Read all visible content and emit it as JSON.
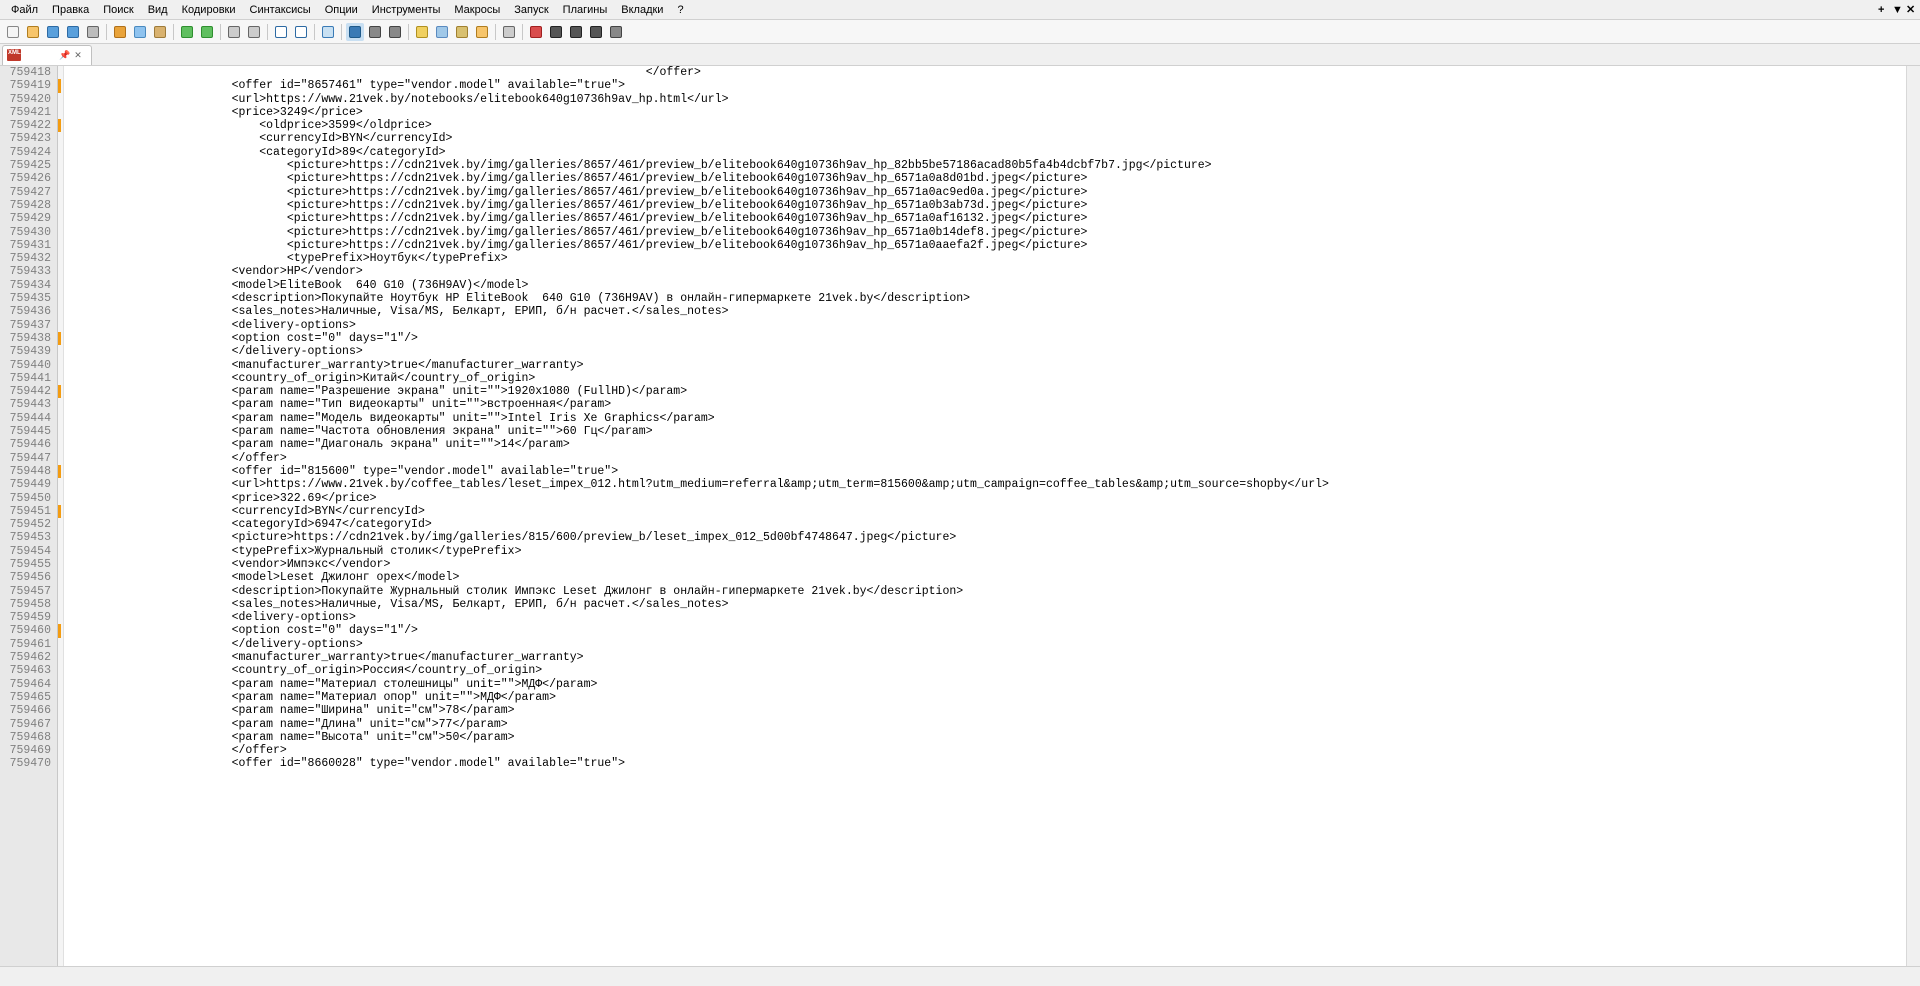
{
  "menu": [
    "Файл",
    "Правка",
    "Поиск",
    "Вид",
    "Кодировки",
    "Синтаксисы",
    "Опции",
    "Инструменты",
    "Макросы",
    "Запуск",
    "Плагины",
    "Вкладки",
    "?"
  ],
  "winbtns": [
    "+",
    "▼",
    "✕"
  ],
  "tab": {
    "pin_icon": "📌",
    "close_icon": "✕"
  },
  "line_start": 759418,
  "modified_lines": [
    759419,
    759422,
    759438,
    759442,
    759448,
    759451,
    759460
  ],
  "code_lines": [
    "                                                                                    </offer>",
    "                        <offer id=\"8657461\" type=\"vendor.model\" available=\"true\">",
    "                        <url>https://www.21vek.by/notebooks/elitebook640g10736h9av_hp.html</url>",
    "                        <price>3249</price>",
    "                            <oldprice>3599</oldprice>",
    "                            <currencyId>BYN</currencyId>",
    "                            <categoryId>89</categoryId>",
    "                                <picture>https://cdn21vek.by/img/galleries/8657/461/preview_b/elitebook640g10736h9av_hp_82bb5be57186acad80b5fa4b4dcbf7b7.jpg</picture>",
    "                                <picture>https://cdn21vek.by/img/galleries/8657/461/preview_b/elitebook640g10736h9av_hp_6571a0a8d01bd.jpeg</picture>",
    "                                <picture>https://cdn21vek.by/img/galleries/8657/461/preview_b/elitebook640g10736h9av_hp_6571a0ac9ed0a.jpeg</picture>",
    "                                <picture>https://cdn21vek.by/img/galleries/8657/461/preview_b/elitebook640g10736h9av_hp_6571a0b3ab73d.jpeg</picture>",
    "                                <picture>https://cdn21vek.by/img/galleries/8657/461/preview_b/elitebook640g10736h9av_hp_6571a0af16132.jpeg</picture>",
    "                                <picture>https://cdn21vek.by/img/galleries/8657/461/preview_b/elitebook640g10736h9av_hp_6571a0b14def8.jpeg</picture>",
    "                                <picture>https://cdn21vek.by/img/galleries/8657/461/preview_b/elitebook640g10736h9av_hp_6571a0aaefa2f.jpeg</picture>",
    "                                <typePrefix>Ноутбук</typePrefix>",
    "                        <vendor>HP</vendor>",
    "                        <model>EliteBook  640 G10 (736H9AV)</model>",
    "                        <description>Покупайте Ноутбук HP EliteBook  640 G10 (736H9AV) в онлайн-гипермаркете 21vek.by</description>",
    "                        <sales_notes>Наличные, Visa/MS, Белкарт, ЕРИП, б/н расчет.</sales_notes>",
    "                        <delivery-options>",
    "                        <option cost=\"0\" days=\"1\"/>",
    "                        </delivery-options>",
    "                        <manufacturer_warranty>true</manufacturer_warranty>",
    "                        <country_of_origin>Китай</country_of_origin>",
    "                        <param name=\"Разрешение экрана\" unit=\"\">1920x1080 (FullHD)</param>",
    "                        <param name=\"Тип видеокарты\" unit=\"\">встроенная</param>",
    "                        <param name=\"Модель видеокарты\" unit=\"\">Intel Iris Xe Graphics</param>",
    "                        <param name=\"Частота обновления экрана\" unit=\"\">60 Гц</param>",
    "                        <param name=\"Диагональ экрана\" unit=\"\">14</param>",
    "                        </offer>",
    "                        <offer id=\"815600\" type=\"vendor.model\" available=\"true\">",
    "                        <url>https://www.21vek.by/coffee_tables/leset_impex_012.html?utm_medium=referral&amp;utm_term=815600&amp;utm_campaign=coffee_tables&amp;utm_source=shopby</url>",
    "                        <price>322.69</price>",
    "                        <currencyId>BYN</currencyId>",
    "                        <categoryId>6947</categoryId>",
    "                        <picture>https://cdn21vek.by/img/galleries/815/600/preview_b/leset_impex_012_5d00bf4748647.jpeg</picture>",
    "                        <typePrefix>Журнальный столик</typePrefix>",
    "                        <vendor>Импэкс</vendor>",
    "                        <model>Leset Джилонг орех</model>",
    "                        <description>Покупайте Журнальный столик Импэкс Leset Джилонг в онлайн-гипермаркете 21vek.by</description>",
    "                        <sales_notes>Наличные, Visa/MS, Белкарт, ЕРИП, б/н расчет.</sales_notes>",
    "                        <delivery-options>",
    "                        <option cost=\"0\" days=\"1\"/>",
    "                        </delivery-options>",
    "                        <manufacturer_warranty>true</manufacturer_warranty>",
    "                        <country_of_origin>Россия</country_of_origin>",
    "                        <param name=\"Материал столешницы\" unit=\"\">МДФ</param>",
    "                        <param name=\"Материал опор\" unit=\"\">МДФ</param>",
    "                        <param name=\"Ширина\" unit=\"см\">78</param>",
    "                        <param name=\"Длина\" unit=\"см\">77</param>",
    "                        <param name=\"Высота\" unit=\"см\">50</param>",
    "                        </offer>",
    "                        <offer id=\"8660028\" type=\"vendor.model\" available=\"true\">"
  ],
  "toolbar_icons": [
    {
      "n": "new-file-icon",
      "c": "#f5f5f5",
      "s": "#888"
    },
    {
      "n": "open-file-icon",
      "c": "#f7c56b",
      "s": "#b07d1f"
    },
    {
      "n": "save-icon",
      "c": "#5aa0dc",
      "s": "#2d6aa3"
    },
    {
      "n": "save-all-icon",
      "c": "#5aa0dc",
      "s": "#2d6aa3"
    },
    {
      "n": "print-icon",
      "c": "#bcbcbc",
      "s": "#666"
    },
    {
      "n": "sep"
    },
    {
      "n": "cut-icon",
      "c": "#e9a33a",
      "s": "#b0701a"
    },
    {
      "n": "copy-icon",
      "c": "#8fc3ef",
      "s": "#4a8abf"
    },
    {
      "n": "paste-icon",
      "c": "#d9b26f",
      "s": "#9e7b3a"
    },
    {
      "n": "sep"
    },
    {
      "n": "undo-icon",
      "c": "#5fbf5f",
      "s": "#2f8f2f"
    },
    {
      "n": "redo-icon",
      "c": "#5fbf5f",
      "s": "#2f8f2f"
    },
    {
      "n": "sep"
    },
    {
      "n": "find-icon",
      "c": "#cccccc",
      "s": "#666"
    },
    {
      "n": "replace-icon",
      "c": "#cccccc",
      "s": "#666"
    },
    {
      "n": "sep"
    },
    {
      "n": "zoom-in-icon",
      "c": "#ffffff",
      "s": "#2d6aa3"
    },
    {
      "n": "zoom-out-icon",
      "c": "#ffffff",
      "s": "#2d6aa3"
    },
    {
      "n": "sep"
    },
    {
      "n": "sync-scroll-icon",
      "c": "#c8e0f2",
      "s": "#3a7ab5"
    },
    {
      "n": "sep"
    },
    {
      "n": "wrap-icon",
      "c": "#3a7ab5",
      "s": "#1f5a8a",
      "hl": true
    },
    {
      "n": "all-chars-icon",
      "c": "#888",
      "s": "#444"
    },
    {
      "n": "indent-guide-icon",
      "c": "#888",
      "s": "#444"
    },
    {
      "n": "sep"
    },
    {
      "n": "lang-icon",
      "c": "#f0d060",
      "s": "#b09020"
    },
    {
      "n": "doc-map-icon",
      "c": "#a0c8e8",
      "s": "#5a8abf"
    },
    {
      "n": "func-list-icon",
      "c": "#d8c070",
      "s": "#a08030"
    },
    {
      "n": "folder-icon",
      "c": "#f7c56b",
      "s": "#b07d1f"
    },
    {
      "n": "sep"
    },
    {
      "n": "monitor-icon",
      "c": "#cccccc",
      "s": "#666"
    },
    {
      "n": "sep"
    },
    {
      "n": "record-icon",
      "c": "#d94c4c",
      "s": "#a02020"
    },
    {
      "n": "stop-icon",
      "c": "#555",
      "s": "#222"
    },
    {
      "n": "play-icon",
      "c": "#555",
      "s": "#222"
    },
    {
      "n": "play-multi-icon",
      "c": "#555",
      "s": "#222"
    },
    {
      "n": "save-macro-icon",
      "c": "#888",
      "s": "#444"
    }
  ]
}
